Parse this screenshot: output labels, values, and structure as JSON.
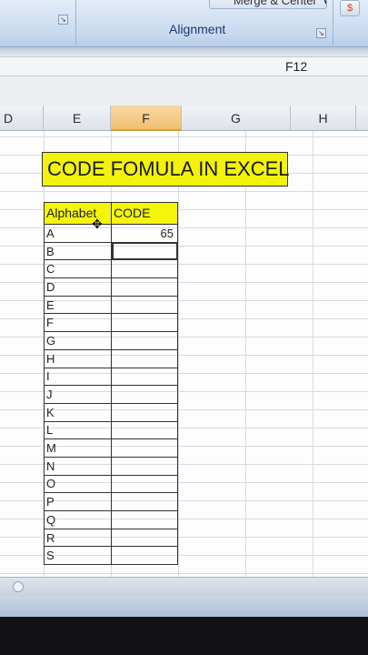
{
  "ribbon": {
    "merge_center_label": "Merge & Center",
    "merge_caret": "▾",
    "alignment_group_label": "Alignment",
    "launcher_glyph": "↘"
  },
  "formula_bar": {
    "name_box": "F12"
  },
  "columns": [
    {
      "label": "D",
      "active": false
    },
    {
      "label": "E",
      "active": false
    },
    {
      "label": "F",
      "active": true
    },
    {
      "label": "G",
      "active": false
    },
    {
      "label": "H",
      "active": false
    }
  ],
  "sheet": {
    "title": "CODE FOMULA IN EXCEL",
    "table": {
      "headers": [
        "Alphabet",
        "CODE"
      ],
      "rows": [
        {
          "alpha": "A",
          "code": "65"
        },
        {
          "alpha": "B",
          "code": ""
        },
        {
          "alpha": "C",
          "code": ""
        },
        {
          "alpha": "D",
          "code": ""
        },
        {
          "alpha": "E",
          "code": ""
        },
        {
          "alpha": "F",
          "code": ""
        },
        {
          "alpha": "G",
          "code": ""
        },
        {
          "alpha": "H",
          "code": ""
        },
        {
          "alpha": "I",
          "code": ""
        },
        {
          "alpha": "J",
          "code": ""
        },
        {
          "alpha": "K",
          "code": ""
        },
        {
          "alpha": "L",
          "code": ""
        },
        {
          "alpha": "M",
          "code": ""
        },
        {
          "alpha": "N",
          "code": ""
        },
        {
          "alpha": "O",
          "code": ""
        },
        {
          "alpha": "P",
          "code": ""
        },
        {
          "alpha": "Q",
          "code": ""
        },
        {
          "alpha": "R",
          "code": ""
        },
        {
          "alpha": "S",
          "code": ""
        }
      ]
    },
    "cursor_glyph": "✥"
  },
  "colors": {
    "title_fill": "#f2f20a",
    "header_fill": "#f4f40c",
    "active_column": "#f0bf6e"
  }
}
